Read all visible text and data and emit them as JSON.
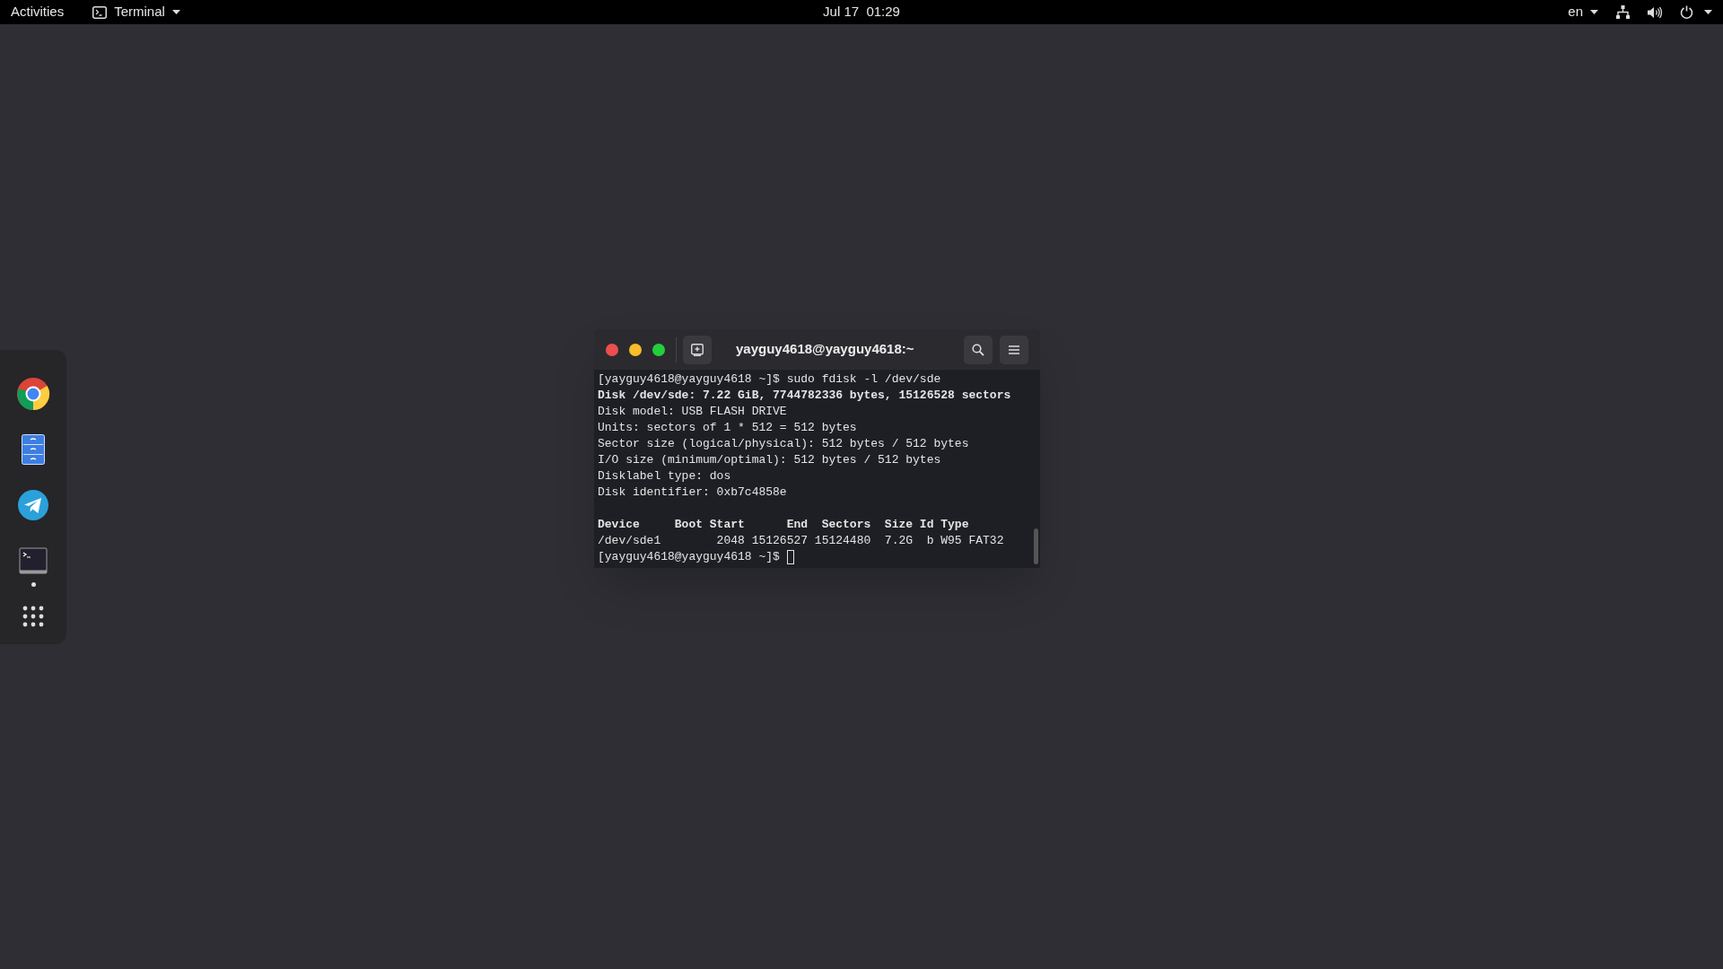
{
  "top_bar": {
    "activities": "Activities",
    "app_menu": "Terminal",
    "clock": "Jul 17  01:29",
    "keyboard_layout": "en"
  },
  "dock": {
    "items": [
      {
        "kind": "browser",
        "running": false
      },
      {
        "kind": "files",
        "running": false
      },
      {
        "kind": "messenger",
        "running": false
      },
      {
        "kind": "terminal",
        "running": true
      },
      {
        "kind": "apps",
        "running": false
      }
    ]
  },
  "terminal": {
    "title": "yayguy4618@yayguy4618:~",
    "lines": [
      {
        "kind": "text",
        "text": "[yayguy4618@yayguy4618 ~]$ sudo fdisk -l /dev/sde"
      },
      {
        "kind": "bold",
        "text": "Disk /dev/sde: 7.22 GiB, 7744782336 bytes, 15126528 sectors"
      },
      {
        "kind": "text",
        "text": "Disk model: USB FLASH DRIVE"
      },
      {
        "kind": "text",
        "text": "Units: sectors of 1 * 512 = 512 bytes"
      },
      {
        "kind": "text",
        "text": "Sector size (logical/physical): 512 bytes / 512 bytes"
      },
      {
        "kind": "text",
        "text": "I/O size (minimum/optimal): 512 bytes / 512 bytes"
      },
      {
        "kind": "text",
        "text": "Disklabel type: dos"
      },
      {
        "kind": "text",
        "text": "Disk identifier: 0xb7c4858e"
      },
      {
        "kind": "blank"
      },
      {
        "kind": "bold",
        "text": "Device     Boot Start      End  Sectors  Size Id Type"
      },
      {
        "kind": "text",
        "text": "/dev/sde1        2048 15126527 15124480  7.2G  b W95 FAT32"
      }
    ],
    "prompt": "[yayguy4618@yayguy4618 ~]$ "
  }
}
